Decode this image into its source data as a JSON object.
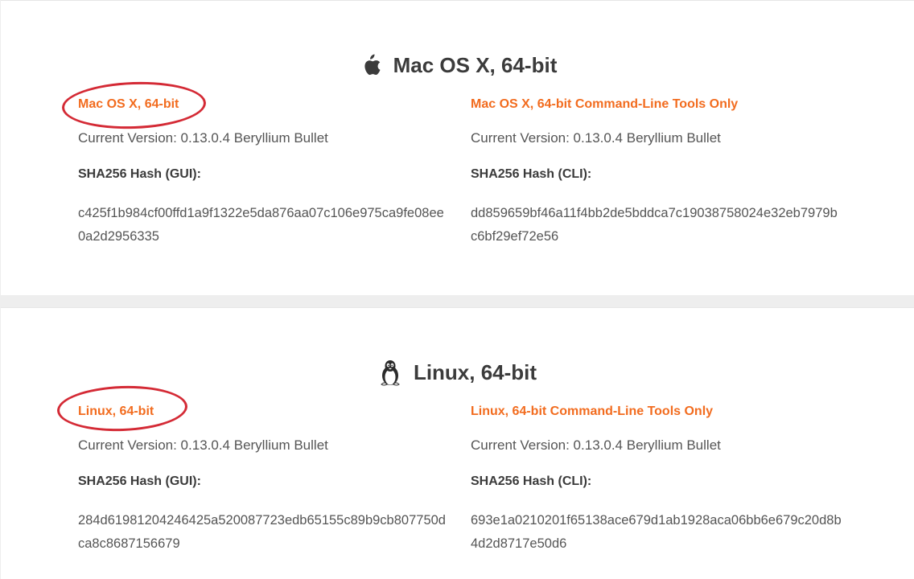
{
  "colors": {
    "link": "#f26c1f",
    "highlight": "#d42a35",
    "title": "#3b3b3b",
    "text": "#555555"
  },
  "mac": {
    "title": "Mac OS X, 64-bit",
    "icon": "apple-icon",
    "gui": {
      "link": "Mac OS X, 64-bit",
      "version": "Current Version: 0.13.0.4 Beryllium Bullet",
      "hash_label": "SHA256 Hash (GUI):",
      "hash_value": "c425f1b984cf00ffd1a9f1322e5da876aa07c106e975ca9fe08ee0a2d2956335"
    },
    "cli": {
      "link": "Mac OS X, 64-bit Command-Line Tools Only",
      "version": "Current Version: 0.13.0.4 Beryllium Bullet",
      "hash_label": "SHA256 Hash (CLI):",
      "hash_value": "dd859659bf46a11f4bb2de5bddca7c19038758024e32eb7979bc6bf29ef72e56"
    }
  },
  "linux": {
    "title": "Linux, 64-bit",
    "icon": "tux-penguin-icon",
    "gui": {
      "link": "Linux, 64-bit",
      "version": "Current Version: 0.13.0.4 Beryllium Bullet",
      "hash_label": "SHA256 Hash (GUI):",
      "hash_value": "284d61981204246425a520087723edb65155c89b9cb807750dca8c8687156679"
    },
    "cli": {
      "link": "Linux, 64-bit Command-Line Tools Only",
      "version": "Current Version: 0.13.0.4 Beryllium Bullet",
      "hash_label": "SHA256 Hash (CLI):",
      "hash_value": "693e1a0210201f65138ace679d1ab1928aca06bb6e679c20d8b4d2d8717e50d6"
    }
  }
}
